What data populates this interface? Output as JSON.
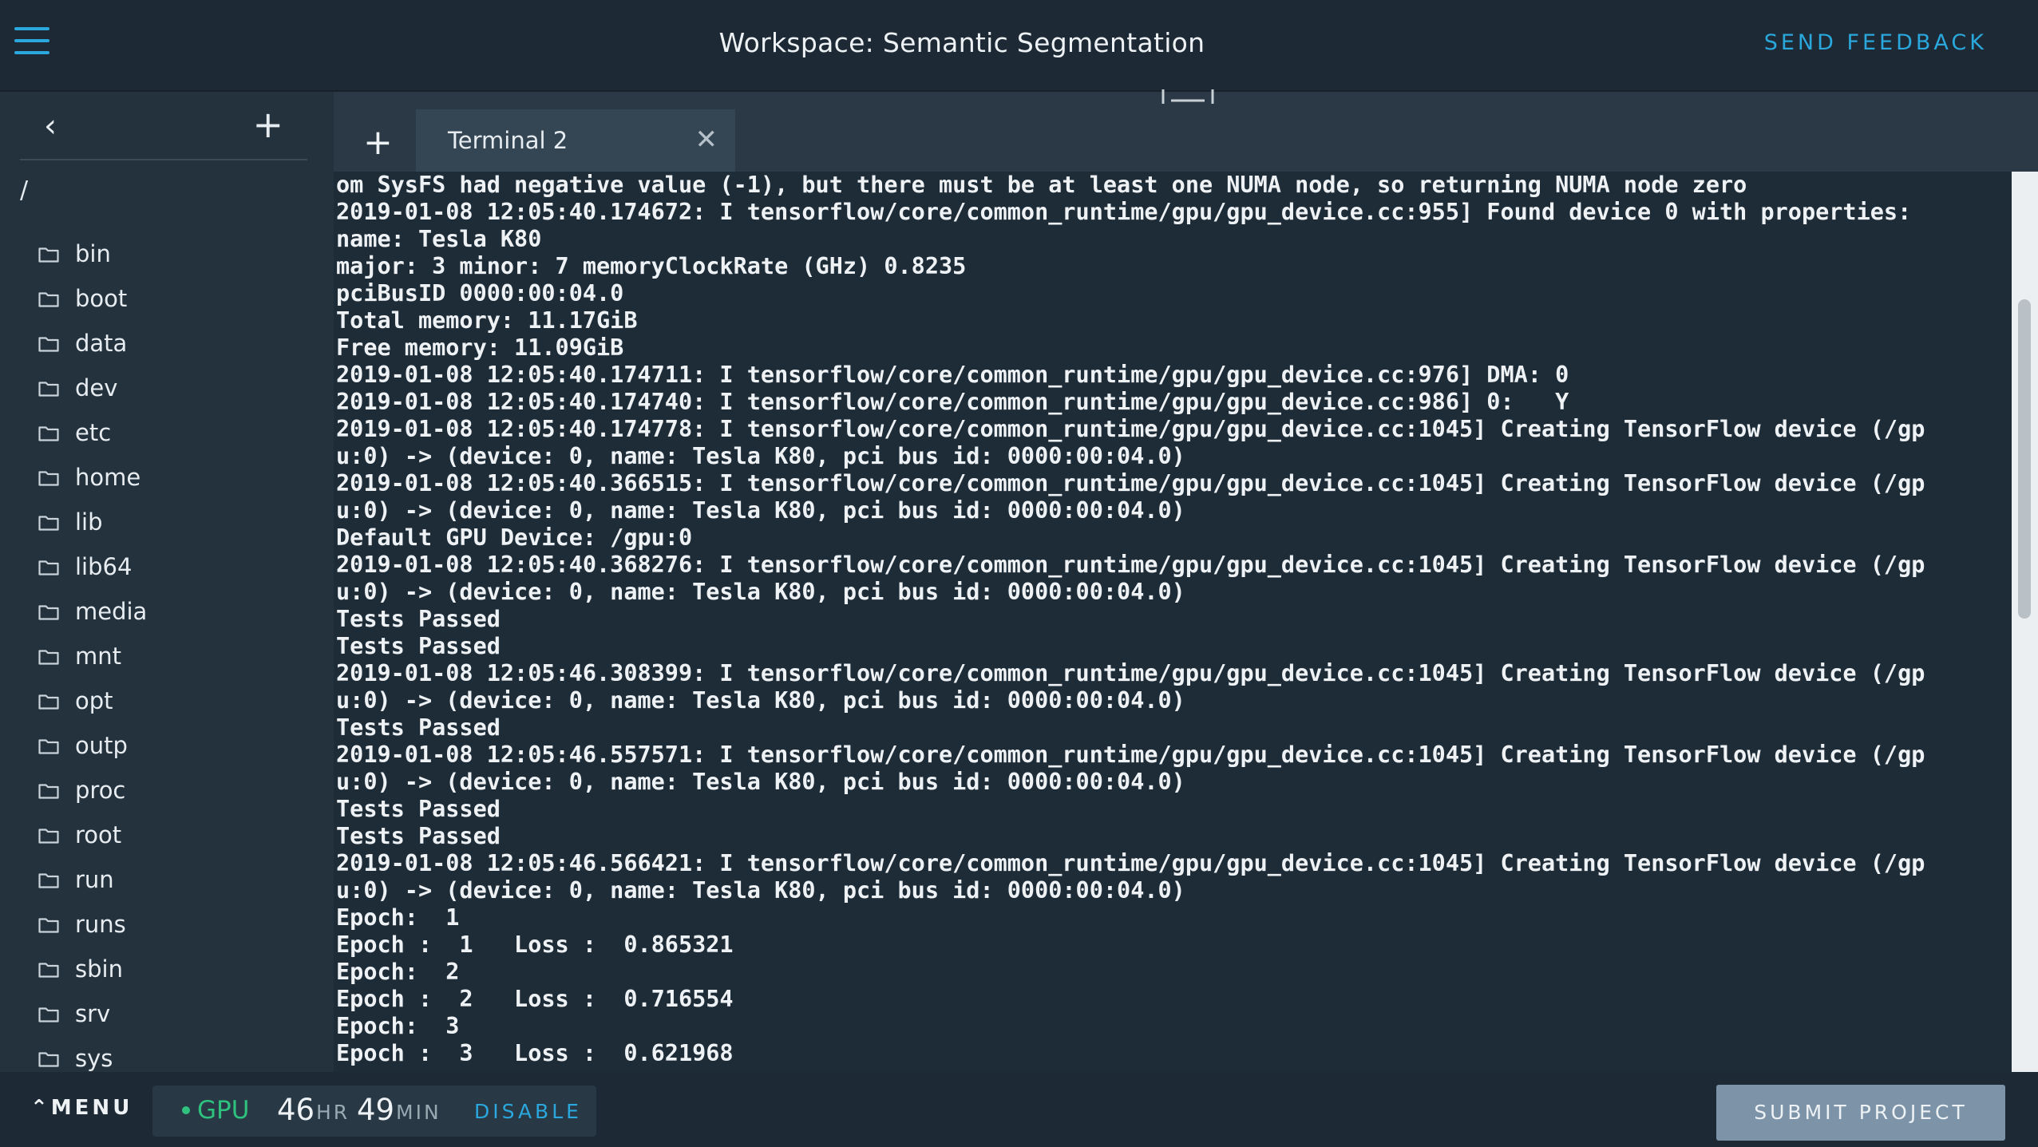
{
  "header": {
    "title": "Workspace: Semantic Segmentation",
    "feedback_label": "SEND FEEDBACK"
  },
  "sidebar": {
    "path": "/",
    "items": [
      {
        "label": "bin"
      },
      {
        "label": "boot"
      },
      {
        "label": "data"
      },
      {
        "label": "dev"
      },
      {
        "label": "etc"
      },
      {
        "label": "home"
      },
      {
        "label": "lib"
      },
      {
        "label": "lib64"
      },
      {
        "label": "media"
      },
      {
        "label": "mnt"
      },
      {
        "label": "opt"
      },
      {
        "label": "outp"
      },
      {
        "label": "proc"
      },
      {
        "label": "root"
      },
      {
        "label": "run"
      },
      {
        "label": "runs"
      },
      {
        "label": "sbin"
      },
      {
        "label": "srv"
      },
      {
        "label": "sys"
      }
    ]
  },
  "tabs": {
    "new_tab_icon": "+",
    "active_label": "Terminal 2",
    "close_icon": "✕"
  },
  "terminal": {
    "lines": [
      "om SysFS had negative value (-1), but there must be at least one NUMA node, so returning NUMA node zero",
      "2019-01-08 12:05:40.174672: I tensorflow/core/common_runtime/gpu/gpu_device.cc:955] Found device 0 with properties:",
      "name: Tesla K80",
      "major: 3 minor: 7 memoryClockRate (GHz) 0.8235",
      "pciBusID 0000:00:04.0",
      "Total memory: 11.17GiB",
      "Free memory: 11.09GiB",
      "2019-01-08 12:05:40.174711: I tensorflow/core/common_runtime/gpu/gpu_device.cc:976] DMA: 0",
      "2019-01-08 12:05:40.174740: I tensorflow/core/common_runtime/gpu/gpu_device.cc:986] 0:   Y",
      "2019-01-08 12:05:40.174778: I tensorflow/core/common_runtime/gpu/gpu_device.cc:1045] Creating TensorFlow device (/gp",
      "u:0) -> (device: 0, name: Tesla K80, pci bus id: 0000:00:04.0)",
      "2019-01-08 12:05:40.366515: I tensorflow/core/common_runtime/gpu/gpu_device.cc:1045] Creating TensorFlow device (/gp",
      "u:0) -> (device: 0, name: Tesla K80, pci bus id: 0000:00:04.0)",
      "Default GPU Device: /gpu:0",
      "2019-01-08 12:05:40.368276: I tensorflow/core/common_runtime/gpu/gpu_device.cc:1045] Creating TensorFlow device (/gp",
      "u:0) -> (device: 0, name: Tesla K80, pci bus id: 0000:00:04.0)",
      "Tests Passed",
      "Tests Passed",
      "2019-01-08 12:05:46.308399: I tensorflow/core/common_runtime/gpu/gpu_device.cc:1045] Creating TensorFlow device (/gp",
      "u:0) -> (device: 0, name: Tesla K80, pci bus id: 0000:00:04.0)",
      "Tests Passed",
      "2019-01-08 12:05:46.557571: I tensorflow/core/common_runtime/gpu/gpu_device.cc:1045] Creating TensorFlow device (/gp",
      "u:0) -> (device: 0, name: Tesla K80, pci bus id: 0000:00:04.0)",
      "Tests Passed",
      "Tests Passed",
      "2019-01-08 12:05:46.566421: I tensorflow/core/common_runtime/gpu/gpu_device.cc:1045] Creating TensorFlow device (/gp",
      "u:0) -> (device: 0, name: Tesla K80, pci bus id: 0000:00:04.0)",
      "Epoch:  1",
      "Epoch :  1   Loss :  0.865321",
      "Epoch:  2",
      "Epoch :  2   Loss :  0.716554",
      "Epoch:  3",
      "Epoch :  3   Loss :  0.621968"
    ]
  },
  "footer": {
    "menu_label": "MENU",
    "gpu_label": "GPU",
    "hours": "46",
    "hours_unit": "HR",
    "minutes": "49",
    "minutes_unit": "MIN",
    "disable_label": "DISABLE",
    "submit_label": "SUBMIT PROJECT"
  },
  "colors": {
    "accent": "#2aa7dc",
    "gpu_active": "#2ec27e",
    "submit_button": "#7c93a8"
  }
}
